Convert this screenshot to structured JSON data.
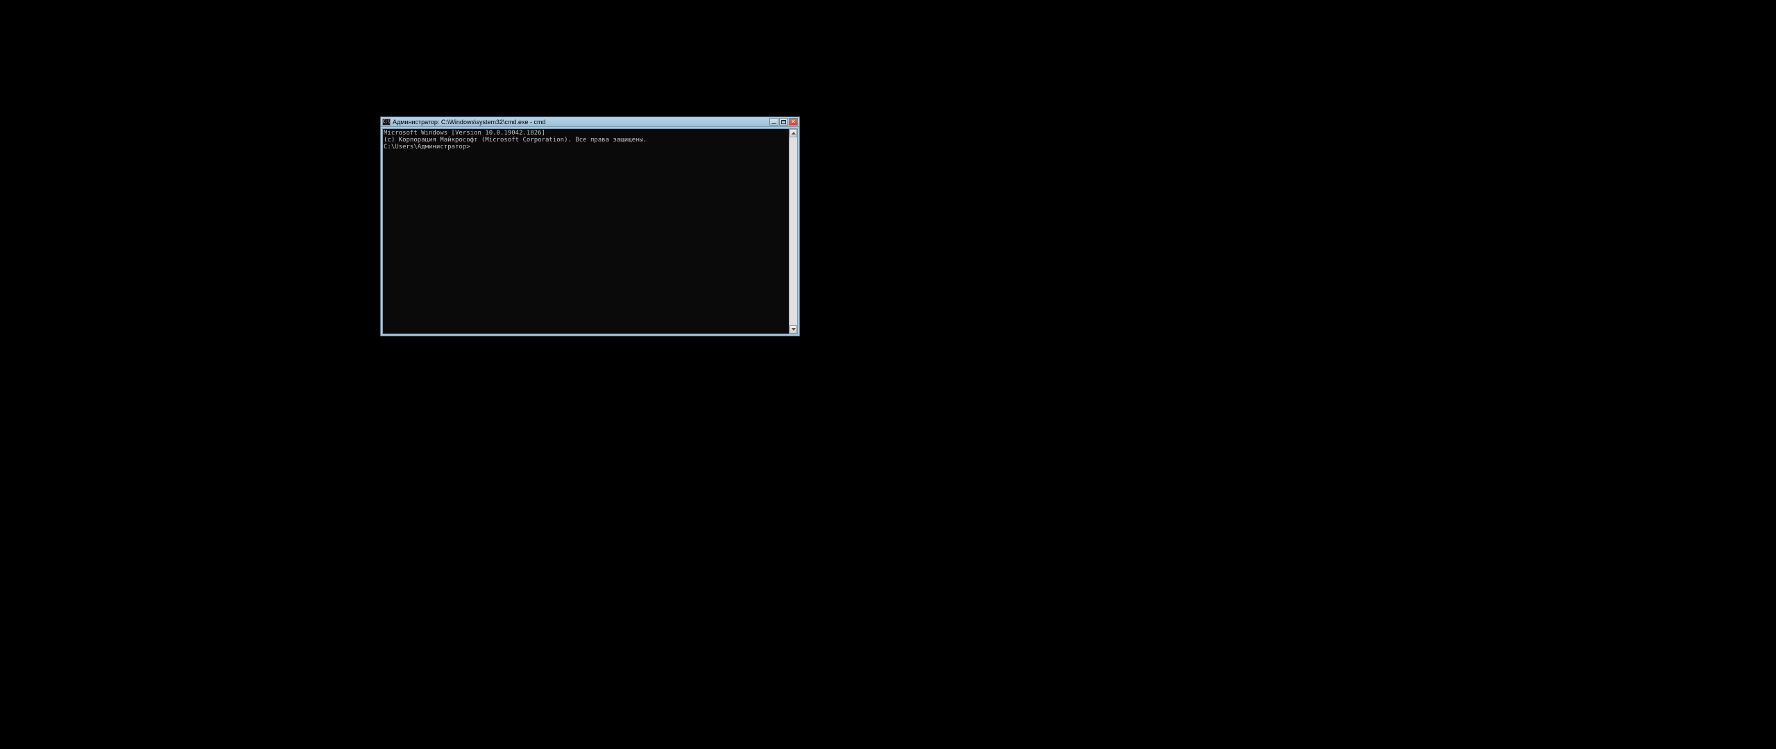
{
  "window": {
    "title": "Администратор: C:\\Windows\\system32\\cmd.exe - cmd",
    "icon_label": "cmd-icon",
    "icon_text": "C:\\"
  },
  "console": {
    "line1": "Microsoft Windows [Version 10.0.19042.1826]",
    "line2": "(c) Корпорация Майкрософт (Microsoft Corporation). Все права защищены.",
    "blank": "",
    "prompt": "C:\\Users\\Администратор>"
  },
  "buttons": {
    "minimize": "Minimize",
    "maximize": "Maximize",
    "close": "Close"
  },
  "colors": {
    "window_frame": "#a8c8e0",
    "console_bg": "#0a0a0a",
    "console_fg": "#c0c0c0",
    "close_btn": "#d04820"
  }
}
